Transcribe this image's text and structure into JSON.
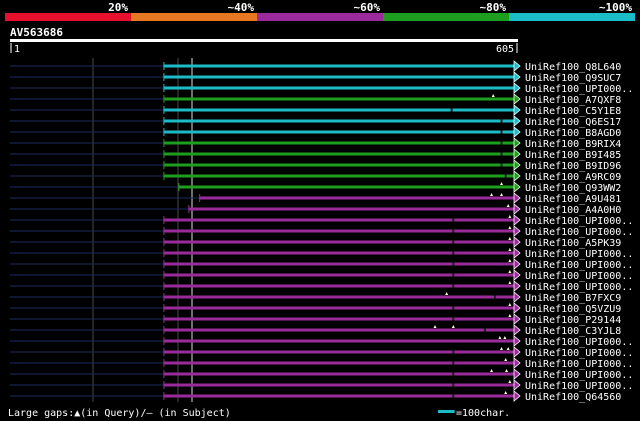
{
  "legend_scale": {
    "labels": [
      "20%",
      "~40%",
      "~60%",
      "~80%",
      "~100%"
    ],
    "colors": [
      "#e8112d",
      "#e87722",
      "#9b2b9b",
      "#1e9e1e",
      "#1bbcc7"
    ]
  },
  "query": {
    "id": "AV563686",
    "start_label": "1",
    "end_label": "605",
    "length": 605
  },
  "hits": [
    {
      "name": "UniRef100_Q8L640",
      "color": "#1bbcc7",
      "start": 220,
      "end": 605,
      "marks": []
    },
    {
      "name": "UniRef100_Q9SUC7",
      "color": "#1bbcc7",
      "start": 220,
      "end": 605,
      "marks": []
    },
    {
      "name": "UniRef100_UPI000..",
      "color": "#1bbcc7",
      "start": 220,
      "end": 605,
      "marks": []
    },
    {
      "name": "UniRef100_A7QXF8",
      "color": "#1e9e1e",
      "start": 220,
      "end": 605,
      "marks": [
        {
          "pos": 580,
          "kind": "query"
        }
      ]
    },
    {
      "name": "UniRef100_C5Y1E8",
      "color": "#1bbcc7",
      "start": 220,
      "end": 605,
      "marks": [
        {
          "pos": 530,
          "kind": "subject"
        }
      ]
    },
    {
      "name": "UniRef100_Q6ES17",
      "color": "#1bbcc7",
      "start": 220,
      "end": 605,
      "marks": [
        {
          "pos": 590,
          "kind": "subject"
        }
      ]
    },
    {
      "name": "UniRef100_B8AGD0",
      "color": "#1bbcc7",
      "start": 220,
      "end": 605,
      "marks": [
        {
          "pos": 590,
          "kind": "subject"
        }
      ]
    },
    {
      "name": "UniRef100_B9RIX4",
      "color": "#1e9e1e",
      "start": 220,
      "end": 605,
      "marks": [
        {
          "pos": 590,
          "kind": "subject"
        }
      ]
    },
    {
      "name": "UniRef100_B9I485",
      "color": "#1e9e1e",
      "start": 220,
      "end": 605,
      "marks": [
        {
          "pos": 590,
          "kind": "subject"
        }
      ]
    },
    {
      "name": "UniRef100_B9ID96",
      "color": "#1e9e1e",
      "start": 220,
      "end": 605,
      "marks": [
        {
          "pos": 590,
          "kind": "subject"
        }
      ]
    },
    {
      "name": "UniRef100_A9RC09",
      "color": "#1e9e1e",
      "start": 220,
      "end": 605,
      "marks": [
        {
          "pos": 595,
          "kind": "subject"
        }
      ]
    },
    {
      "name": "UniRef100_Q93WW2",
      "color": "#1e9e1e",
      "start": 238,
      "end": 605,
      "marks": [
        {
          "pos": 590,
          "kind": "query"
        }
      ]
    },
    {
      "name": "UniRef100_A9U481",
      "color": "#9b2b9b",
      "start": 263,
      "end": 605,
      "marks": [
        {
          "pos": 578,
          "kind": "query"
        },
        {
          "pos": 590,
          "kind": "query"
        }
      ]
    },
    {
      "name": "UniRef100_A4A0H0",
      "color": "#9b2b9b",
      "start": 250,
      "end": 605,
      "marks": [
        {
          "pos": 598,
          "kind": "query"
        }
      ]
    },
    {
      "name": "UniRef100_UPI000..",
      "color": "#9b2b9b",
      "start": 220,
      "end": 605,
      "marks": [
        {
          "pos": 532,
          "kind": "subject"
        },
        {
          "pos": 600,
          "kind": "query"
        }
      ]
    },
    {
      "name": "UniRef100_UPI000..",
      "color": "#9b2b9b",
      "start": 220,
      "end": 605,
      "marks": [
        {
          "pos": 532,
          "kind": "subject"
        },
        {
          "pos": 600,
          "kind": "query"
        }
      ]
    },
    {
      "name": "UniRef100_A5PK39",
      "color": "#9b2b9b",
      "start": 220,
      "end": 605,
      "marks": [
        {
          "pos": 532,
          "kind": "subject"
        },
        {
          "pos": 600,
          "kind": "query"
        }
      ]
    },
    {
      "name": "UniRef100_UPI000..",
      "color": "#9b2b9b",
      "start": 220,
      "end": 605,
      "marks": [
        {
          "pos": 532,
          "kind": "subject"
        },
        {
          "pos": 600,
          "kind": "query"
        }
      ]
    },
    {
      "name": "UniRef100_UPI000..",
      "color": "#9b2b9b",
      "start": 220,
      "end": 605,
      "marks": [
        {
          "pos": 532,
          "kind": "subject"
        },
        {
          "pos": 600,
          "kind": "query"
        }
      ]
    },
    {
      "name": "UniRef100_UPI000..",
      "color": "#9b2b9b",
      "start": 220,
      "end": 605,
      "marks": [
        {
          "pos": 532,
          "kind": "subject"
        },
        {
          "pos": 600,
          "kind": "query"
        }
      ]
    },
    {
      "name": "UniRef100_UPI000..",
      "color": "#9b2b9b",
      "start": 220,
      "end": 605,
      "marks": [
        {
          "pos": 532,
          "kind": "subject"
        },
        {
          "pos": 600,
          "kind": "query"
        }
      ]
    },
    {
      "name": "UniRef100_B7FXC9",
      "color": "#9b2b9b",
      "start": 220,
      "end": 605,
      "marks": [
        {
          "pos": 524,
          "kind": "query"
        },
        {
          "pos": 582,
          "kind": "subject"
        }
      ]
    },
    {
      "name": "UniRef100_Q5VZU9",
      "color": "#9b2b9b",
      "start": 220,
      "end": 605,
      "marks": [
        {
          "pos": 532,
          "kind": "subject"
        },
        {
          "pos": 600,
          "kind": "query"
        }
      ]
    },
    {
      "name": "UniRef100_P29144",
      "color": "#9b2b9b",
      "start": 220,
      "end": 605,
      "marks": [
        {
          "pos": 532,
          "kind": "subject"
        },
        {
          "pos": 600,
          "kind": "query"
        }
      ]
    },
    {
      "name": "UniRef100_C3YJL8",
      "color": "#9b2b9b",
      "start": 220,
      "end": 605,
      "marks": [
        {
          "pos": 510,
          "kind": "query"
        },
        {
          "pos": 532,
          "kind": "query"
        },
        {
          "pos": 570,
          "kind": "subject"
        }
      ]
    },
    {
      "name": "UniRef100_UPI000..",
      "color": "#9b2b9b",
      "start": 220,
      "end": 605,
      "marks": [
        {
          "pos": 588,
          "kind": "query"
        },
        {
          "pos": 594,
          "kind": "query"
        }
      ]
    },
    {
      "name": "UniRef100_UPI000..",
      "color": "#9b2b9b",
      "start": 220,
      "end": 605,
      "marks": [
        {
          "pos": 532,
          "kind": "subject"
        },
        {
          "pos": 590,
          "kind": "query"
        },
        {
          "pos": 598,
          "kind": "query"
        }
      ]
    },
    {
      "name": "UniRef100_UPI000..",
      "color": "#9b2b9b",
      "start": 220,
      "end": 605,
      "marks": [
        {
          "pos": 532,
          "kind": "subject"
        },
        {
          "pos": 595,
          "kind": "query"
        }
      ]
    },
    {
      "name": "UniRef100_UPI000..",
      "color": "#9b2b9b",
      "start": 220,
      "end": 605,
      "marks": [
        {
          "pos": 532,
          "kind": "subject"
        },
        {
          "pos": 578,
          "kind": "query"
        },
        {
          "pos": 596,
          "kind": "query"
        }
      ]
    },
    {
      "name": "UniRef100_UPI000..",
      "color": "#9b2b9b",
      "start": 220,
      "end": 605,
      "marks": [
        {
          "pos": 532,
          "kind": "subject"
        },
        {
          "pos": 600,
          "kind": "query"
        }
      ]
    },
    {
      "name": "UniRef100_Q64560",
      "color": "#9b2b9b",
      "start": 220,
      "end": 605,
      "marks": [
        {
          "pos": 532,
          "kind": "subject"
        },
        {
          "pos": 595,
          "kind": "query"
        }
      ]
    }
  ],
  "footer": {
    "gaps_text": "Large gaps:▲(in Query)/– (in Subject)",
    "scale_text": "=100char.",
    "scale_color": "#1bbcc7",
    "scale_chars": 100
  }
}
